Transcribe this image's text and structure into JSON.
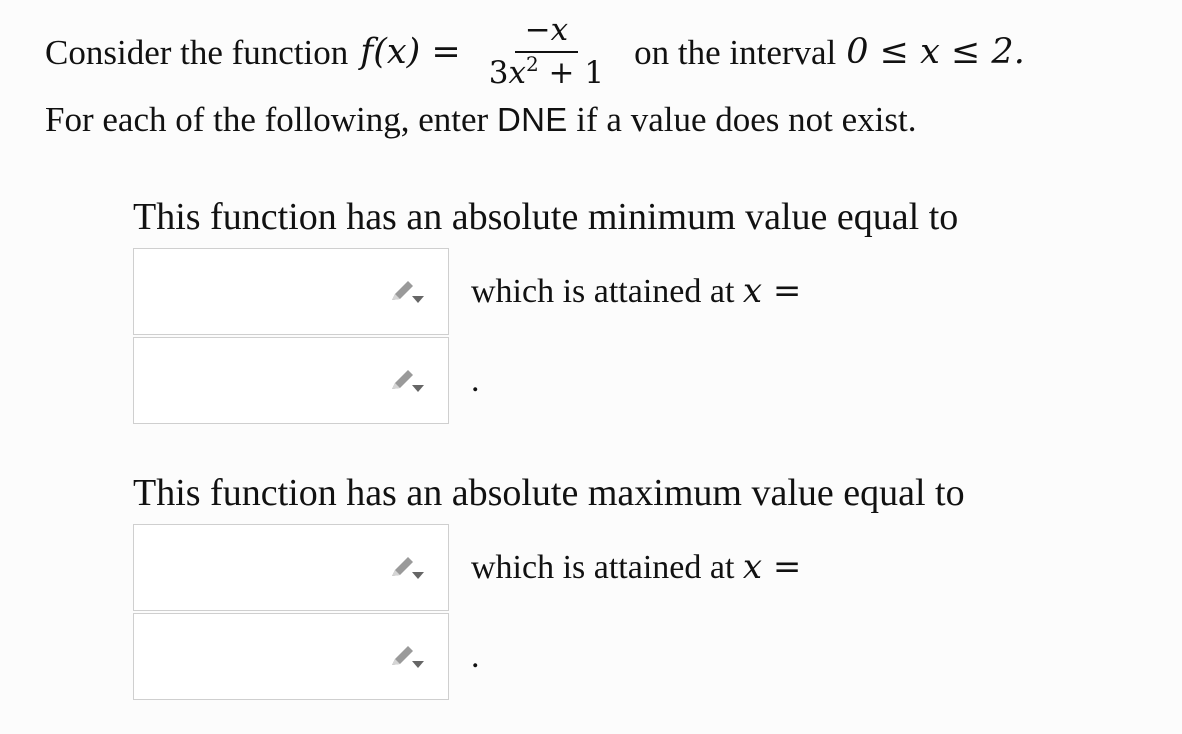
{
  "intro": {
    "consider_label": "Consider the function",
    "function_lhs": "f(x) =",
    "numerator": "−x",
    "denominator_coeff": "3",
    "denominator_var": "x",
    "denominator_exp": "2",
    "denominator_rest": " + 1",
    "interval_text": "on the interval",
    "interval_expr": "0 ≤ x ≤ 2.",
    "instruction_prefix": "For each of the following, enter",
    "instruction_keyword": "DNE",
    "instruction_suffix": "if a value does not exist."
  },
  "minimum": {
    "title": "This function has an absolute minimum value equal to",
    "value_input": {
      "value": "",
      "placeholder": ""
    },
    "after_value_text": "which is attained at",
    "x_equals": "x =",
    "location_input": {
      "value": "",
      "placeholder": ""
    },
    "period": "."
  },
  "maximum": {
    "title": "This function has an absolute maximum value equal to",
    "value_input": {
      "value": "",
      "placeholder": ""
    },
    "after_value_text": "which is attained at",
    "x_equals": "x =",
    "location_input": {
      "value": "",
      "placeholder": ""
    },
    "period": "."
  },
  "icons": {
    "answer_tool": "pencil-icon"
  },
  "colors": {
    "background": "#fcfcfc",
    "text": "#111111",
    "input_border": "#cfcfcf",
    "icon": "#8f8f8f"
  }
}
